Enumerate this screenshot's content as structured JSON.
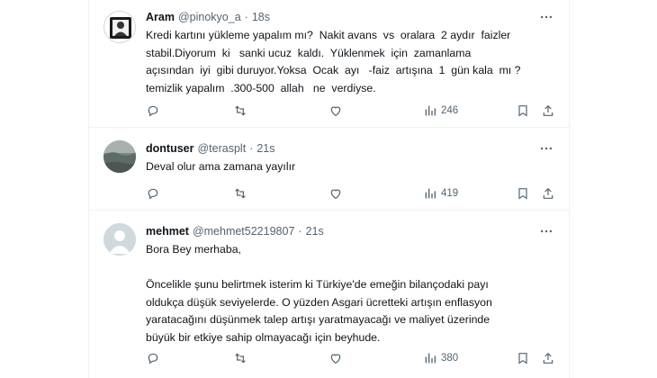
{
  "tweets": [
    {
      "name": "Aram",
      "handle": "@pinokyo_a",
      "time": "18s",
      "text": "Kredi kartını yükleme yapalım mı?  Nakit avans  vs  oralara  2 aydır  faizler\nstabil.Diyorum  ki   sanki ucuz  kaldı.  Yüklenmek  için  zamanlama\naçısından  iyi  gibi duruyor.Yoksa  Ocak  ayı   -faiz  artışına  1  gün kala  mı ?\ntemizlik yapalım  .300-500  allah   ne  verdiyse.",
      "views": "246",
      "avatar_icon": "framed-portrait-icon"
    },
    {
      "name": "dontuser",
      "handle": "@terasplt",
      "time": "21s",
      "text": "Deval olur ama zamana yayılır",
      "views": "419",
      "avatar_icon": "landscape-photo-icon"
    },
    {
      "name": "mehmet",
      "handle": "@mehmet52219807",
      "time": "21s",
      "text": "Bora Bey merhaba,\n\nÖncelikle şunu belirtmek isterim ki Türkiye'de emeğin bilançodaki payı\noldukça düşük seviyelerde. O yüzden Asgari ücretteki artışın enflasyon\nyaratacağını düşünmek talep artışı yaratmayacağı ve maliyet üzerinde\nbüyük bir etkiye sahip olmayacağı için beyhude.",
      "views": "380",
      "avatar_icon": "default-profile-icon"
    }
  ],
  "colors": {
    "text": "#0f1419",
    "secondary": "#536471",
    "divider": "#eff3f4"
  }
}
